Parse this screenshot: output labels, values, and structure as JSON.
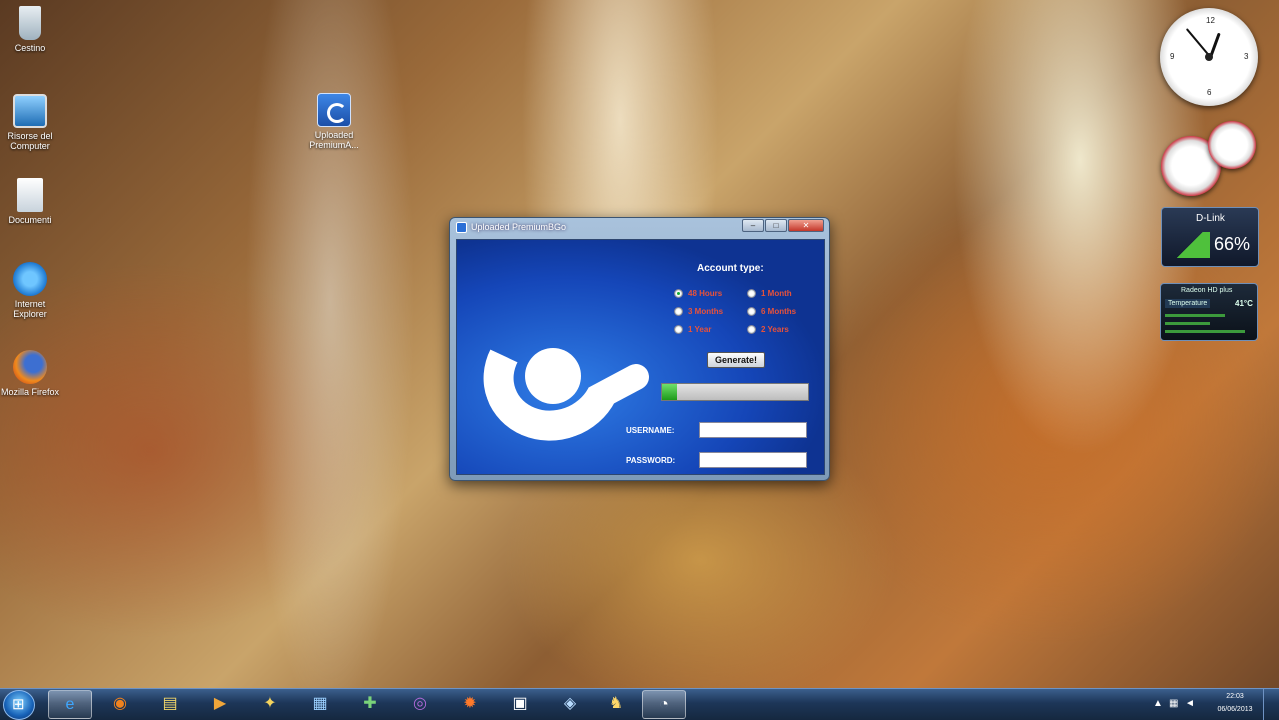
{
  "desktop": {
    "icons": [
      {
        "label": "Cestino",
        "icon": "recycle-bin-icon"
      },
      {
        "label": "Risorse del Computer",
        "icon": "computer-icon"
      },
      {
        "label": "Documenti",
        "icon": "documents-icon"
      },
      {
        "label": "Internet Explorer",
        "icon": "internet-explorer-icon"
      },
      {
        "label": "Mozilla Firefox",
        "icon": "firefox-icon"
      },
      {
        "label": "Uploaded PremiumA...",
        "icon": "uploaded-app-icon"
      }
    ]
  },
  "gadgets": {
    "wifi": {
      "name": "D-Link",
      "percent": "66%"
    },
    "gpu": {
      "name": "Radeon HD plus",
      "temp_label": "Temperature",
      "temp_value": "41°C"
    }
  },
  "window": {
    "title": "Uploaded PremiumBGo",
    "controls": {
      "minimize": "–",
      "maximize": "□",
      "close": "✕"
    },
    "account_type_label": "Account type:",
    "options": [
      {
        "label": "48 Hours",
        "selected": true
      },
      {
        "label": "1 Month",
        "selected": false
      },
      {
        "label": "3 Months",
        "selected": false
      },
      {
        "label": "6 Months",
        "selected": false
      },
      {
        "label": "1 Year",
        "selected": false
      },
      {
        "label": "2 Years",
        "selected": false
      }
    ],
    "generate_label": "Generate!",
    "progress": 0.1,
    "username_label": "USERNAME:",
    "username_value": "",
    "password_label": "PASSWORD:",
    "password_value": "",
    "accent_color": "#1546b8"
  },
  "taskbar": {
    "buttons": [
      {
        "icon": "internet-explorer-icon",
        "glyph": "e",
        "active": true
      },
      {
        "icon": "firefox-icon",
        "glyph": "◉",
        "active": false
      },
      {
        "icon": "folder-icon",
        "glyph": "▤",
        "active": false
      },
      {
        "icon": "media-player-icon",
        "glyph": "▶",
        "active": false
      },
      {
        "icon": "app-icon",
        "glyph": "✦",
        "active": false
      },
      {
        "icon": "network-app-icon",
        "glyph": "▦",
        "active": false
      },
      {
        "icon": "paint-icon",
        "glyph": "✚",
        "active": false
      },
      {
        "icon": "app-purple-icon",
        "glyph": "◎",
        "active": false
      },
      {
        "icon": "flame-app-icon",
        "glyph": "✹",
        "active": false
      },
      {
        "icon": "package-icon",
        "glyph": "▣",
        "active": false
      },
      {
        "icon": "tool-icon",
        "glyph": "◈",
        "active": false
      },
      {
        "icon": "game-icon",
        "glyph": "♞",
        "active": false
      },
      {
        "icon": "uploaded-app-icon",
        "glyph": "◔",
        "active": true
      }
    ],
    "clock_time": "22:03",
    "clock_date": "06/06/2013"
  }
}
